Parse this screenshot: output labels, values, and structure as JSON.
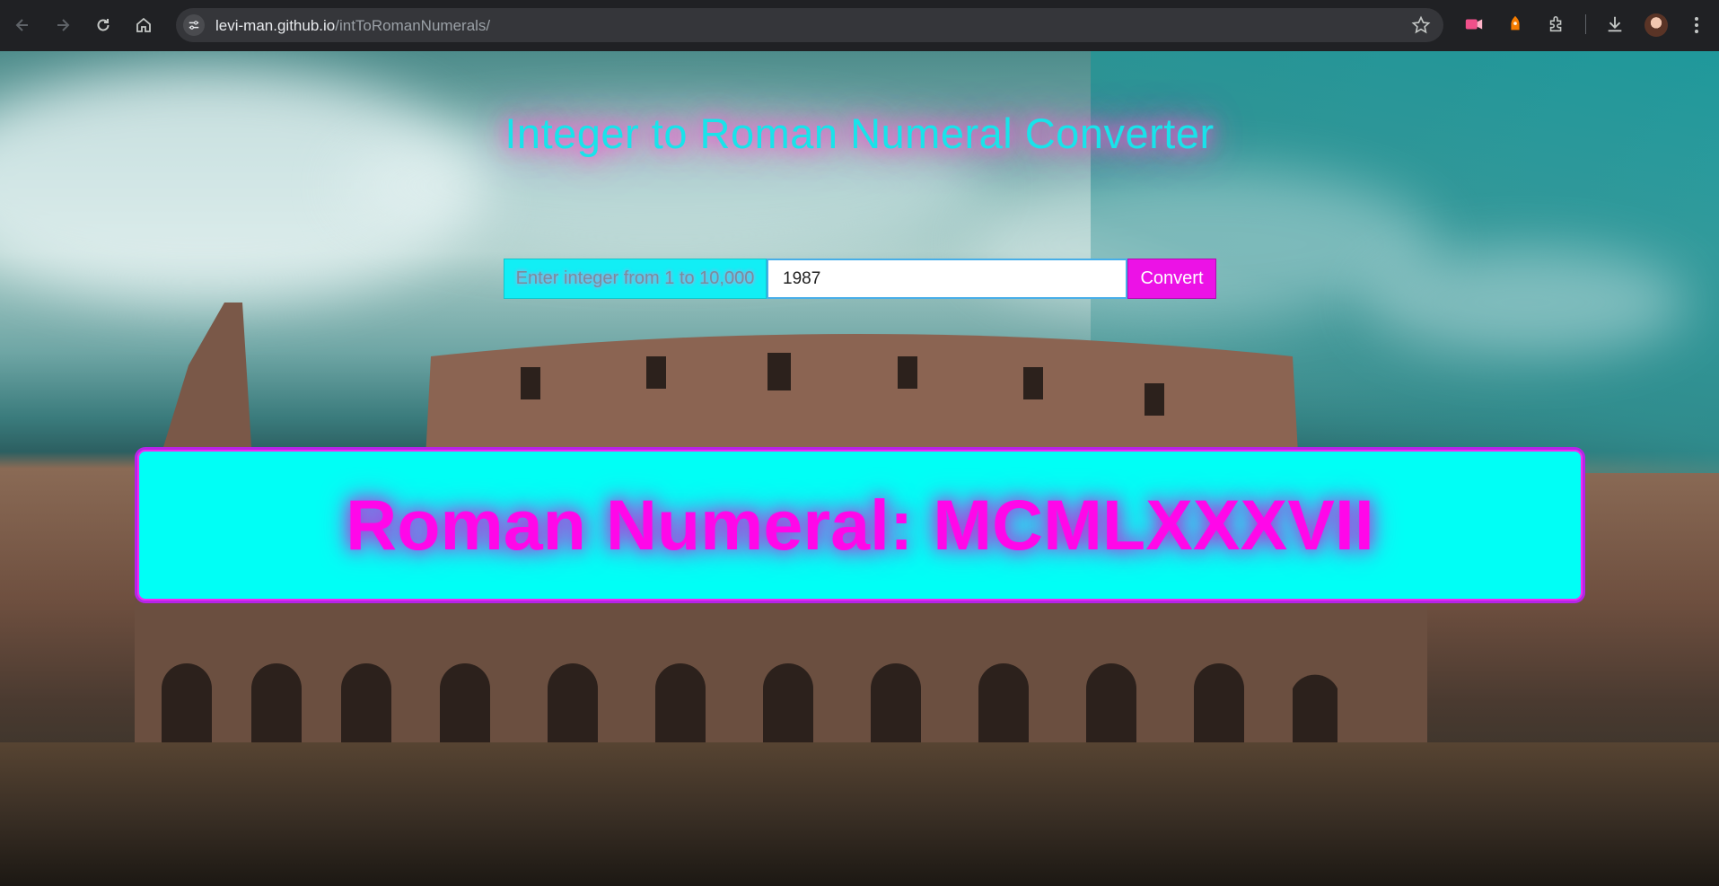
{
  "browser": {
    "url_host": "levi-man.github.io",
    "url_path": "/intToRomanNumerals/",
    "icons": [
      "back-icon",
      "forward-icon",
      "reload-icon",
      "home-icon",
      "site-settings-icon",
      "bookmark-star-icon",
      "extension-icon",
      "extensions-puzzle-icon",
      "download-icon",
      "avatar",
      "menu-icon"
    ]
  },
  "page": {
    "title": "Integer to Roman Numeral Converter",
    "input_label": "Enter integer from 1 to 10,000",
    "input_value": "1987",
    "convert_label": "Convert",
    "result_text": "Roman Numeral: MCMLXXXVII"
  },
  "colors": {
    "title": "#19e3ea",
    "title_glow": "#ff63c6",
    "label_bg": "#12eef5",
    "button_bg": "#ec12e6",
    "result_bg": "#00fff6",
    "result_text": "#ff07e9"
  }
}
